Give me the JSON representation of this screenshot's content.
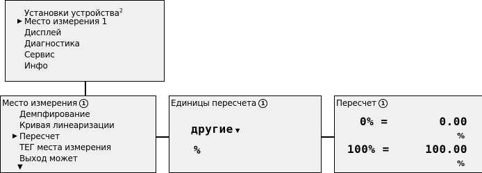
{
  "main_menu": {
    "items": [
      "Установки устройства",
      "Место измерения 1",
      "Дисплей",
      "Диагностика",
      "Сервис",
      "Инфо"
    ],
    "selected_index": 1,
    "footnote": "2",
    "pointer_icon": "triangle-right"
  },
  "menu_place": {
    "title": "Место измерения",
    "info_badge": "1",
    "items": [
      "Демпфирование",
      "Кривая линеаризации",
      "Пересчет",
      "ТЕГ места измерения",
      "Выход может"
    ],
    "selected_index": 2,
    "more_icon": "triangle-down"
  },
  "units_panel": {
    "title": "Единицы пересчета",
    "info_badge": "1",
    "unit_value": "другие",
    "dropdown_icon": "triangle-down",
    "unit_symbol": "%"
  },
  "scaling_panel": {
    "title": "Пересчет",
    "info_badge": "1",
    "row1_label": "0% =",
    "row1_value": "0.00",
    "row1_unit": "%",
    "row2_label": "100% =",
    "row2_value": "100.00",
    "row2_unit": "%"
  }
}
